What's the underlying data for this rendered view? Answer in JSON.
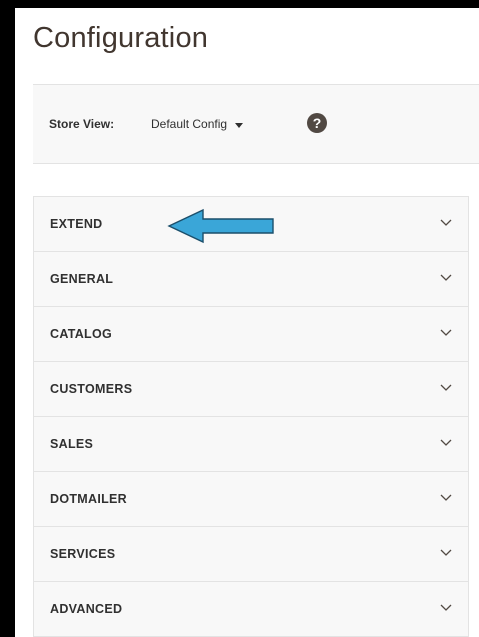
{
  "page": {
    "title": "Configuration"
  },
  "store_view": {
    "label": "Store View:",
    "selected": "Default Config",
    "help_icon": "question-circle-icon"
  },
  "tabs": [
    {
      "label": "EXTEND"
    },
    {
      "label": "GENERAL"
    },
    {
      "label": "CATALOG"
    },
    {
      "label": "CUSTOMERS"
    },
    {
      "label": "SALES"
    },
    {
      "label": "DOTMAILER"
    },
    {
      "label": "SERVICES"
    },
    {
      "label": "ADVANCED"
    }
  ],
  "annotation": {
    "icon": "left-arrow-icon",
    "color": "#3aa6d8"
  },
  "colors": {
    "tab_background": "#f8f8f8",
    "store_bar_background": "#f8f8f8",
    "title": "#41362f",
    "help_icon": "#514943"
  }
}
